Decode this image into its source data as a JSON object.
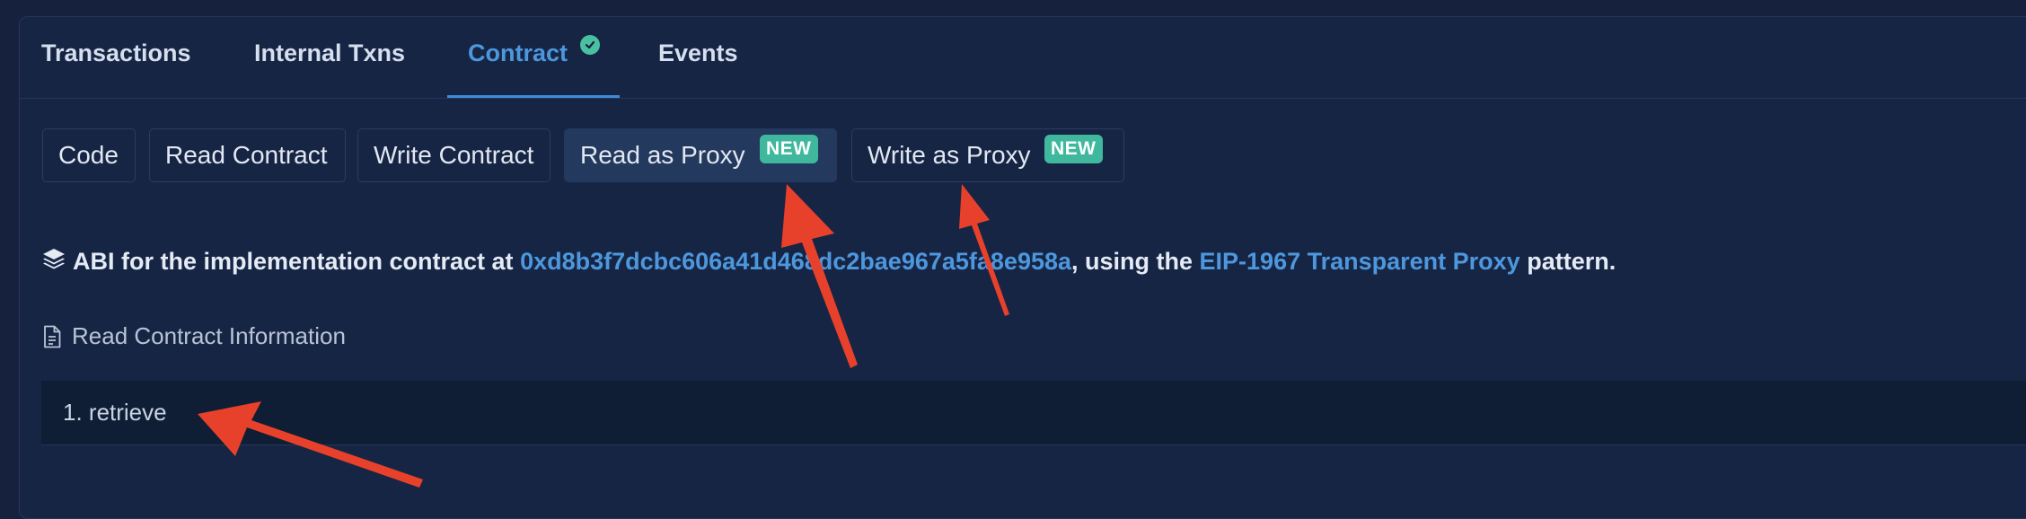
{
  "tabs": [
    {
      "label": "Transactions"
    },
    {
      "label": "Internal Txns"
    },
    {
      "label": "Contract"
    },
    {
      "label": "Events"
    }
  ],
  "subtabs": [
    {
      "label": "Code"
    },
    {
      "label": "Read Contract"
    },
    {
      "label": "Write Contract"
    },
    {
      "label": "Read as Proxy",
      "badge": "NEW"
    },
    {
      "label": "Write as Proxy",
      "badge": "NEW"
    }
  ],
  "abi": {
    "prefix": "ABI for the implementation contract at ",
    "address": "0xd8b3f7dcbc606a41d468dc2bae967a5fa8e958a",
    "middle": ", using the ",
    "pattern_link": "EIP-1967 Transparent Proxy",
    "suffix": " pattern."
  },
  "read_info": {
    "label": "Read Contract Information"
  },
  "functions": [
    {
      "label": "1. retrieve"
    }
  ],
  "colors": {
    "accent": "#4d97dc",
    "badge": "#3fb89e",
    "annotation_arrow": "#e8412b"
  },
  "icons": [
    "check-circle-icon",
    "layers-icon",
    "document-icon"
  ]
}
